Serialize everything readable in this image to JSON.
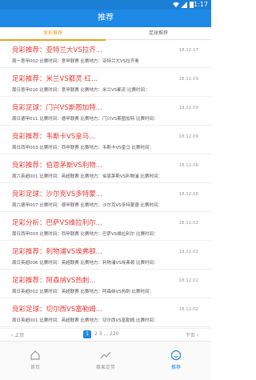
{
  "status": {
    "time": "11:17"
  },
  "header": {
    "title": "推荐"
  },
  "tabs": [
    {
      "label": "竞彩推荐",
      "active": true
    },
    {
      "label": "足球推荐",
      "active": false
    }
  ],
  "list": [
    {
      "title": "竞彩推荐：亚特兰大VS拉齐...",
      "date": "18.12.17",
      "desc": "周一意甲002 比赛时间：意甲联赛 比赛地方：亚特兰大VS拉齐奥"
    },
    {
      "title": "足彩推荐：米兰VS都灵 红...",
      "date": "18.12.09",
      "desc": "周日意甲016 比赛时间：意甲联赛 比赛地方：米兰VS都灵 比赛时间："
    },
    {
      "title": "竞彩足球：门兴VS斯图加特...",
      "date": "18.12.09",
      "desc": "周日德甲011 比赛时间：德甲联赛 比赛地方：门兴VS斯图加特 比赛时间："
    },
    {
      "title": "竞彩推荐：韦斯卡VS皇马...",
      "date": "18.12.09",
      "desc": "周日西甲003 比赛时间：西甲联赛 比赛地方：韦斯卡VS皇马 比赛时间："
    },
    {
      "title": "竞彩推荐：伯恩茅斯VS利物...",
      "date": "18.12.08",
      "desc": "周六英超001 比赛时间：英超联赛 比赛地方：伯恩茅斯VS利物浦 比赛时间："
    },
    {
      "title": "竞彩足球：沙尔克VS多特蒙...",
      "date": "18.12.08",
      "desc": "周六德甲007 比赛时间：德甲联赛 比赛地方：沙尔克VS多特蒙德 比赛时间："
    },
    {
      "title": "足彩分析：巴萨VS维拉利尔...",
      "date": "18.12.02",
      "desc": "周日西甲003 比赛时间：西甲联赛 比赛地方：巴萨VS维拉利尔 比赛时间："
    },
    {
      "title": "足彩推荐：利物浦VS埃弗顿...",
      "date": "18.12.02",
      "desc": "周日英超006 比赛时间：英超联赛 比赛地方：利物浦VS埃弗顿 比赛时间："
    },
    {
      "title": "足彩推荐：阿森纳VS热刺...",
      "date": "18.12.02",
      "desc": "周日英超002 比赛时间：英超联赛 比赛地方：阿森纳VS热刺 比赛时间："
    },
    {
      "title": "竞彩足球：切尔西VS富勒姆...",
      "date": "18.12.02",
      "desc": "周日英超001 比赛时间：英超联赛 比赛地方：切尔西VS富勒姆 比赛时间："
    }
  ],
  "pager": {
    "prev": "‹ 上页",
    "current": "1",
    "pages": "2 3 ... 220",
    "next": "下页 ›"
  },
  "nav": [
    {
      "label": "首页",
      "icon": "home-icon",
      "active": false
    },
    {
      "label": "赛果走势",
      "icon": "trend-icon",
      "active": false
    },
    {
      "label": "推荐",
      "icon": "recommend-icon",
      "active": true
    }
  ],
  "colors": {
    "primary": "#1e88e5",
    "accent": "#e9a31f",
    "title_red": "#e53935"
  }
}
